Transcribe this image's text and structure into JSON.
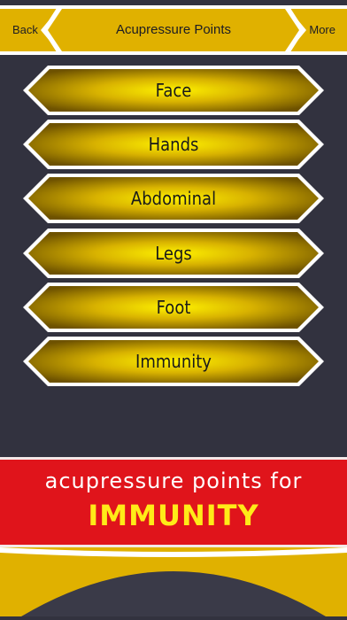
{
  "header": {
    "back_label": "Back",
    "title": "Acupressure Points",
    "more_label": "More"
  },
  "menu": {
    "items": [
      {
        "label": "Face"
      },
      {
        "label": "Hands"
      },
      {
        "label": "Abdominal"
      },
      {
        "label": "Legs"
      },
      {
        "label": "Foot"
      },
      {
        "label": "Immunity"
      }
    ]
  },
  "banner": {
    "line1": "acupressure points for",
    "line2": "IMMUNITY"
  },
  "colors": {
    "background": "#32323f",
    "gold": "#e0b100",
    "banner_red": "#e0141b",
    "banner_highlight": "#ffeb18"
  }
}
